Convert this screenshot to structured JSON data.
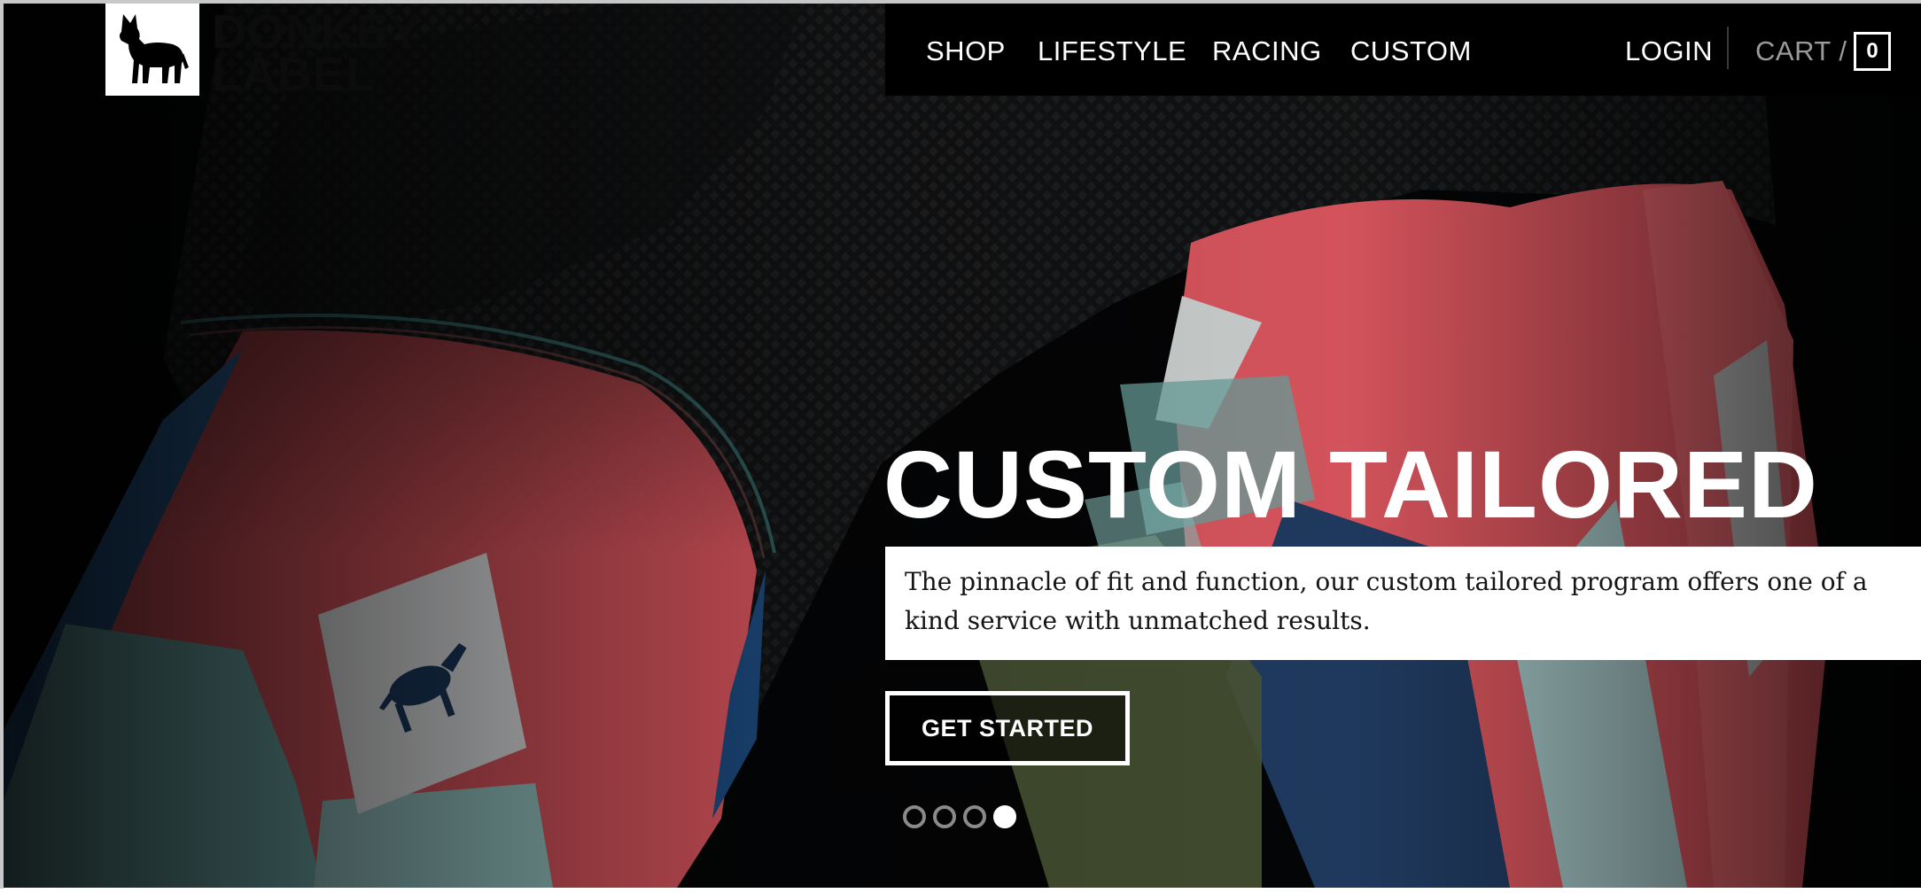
{
  "brand": {
    "logo_alt_text": "DONKEY LABEL",
    "logo_line1": "DONKEY",
    "logo_line2": "LABEL"
  },
  "nav": {
    "items": [
      {
        "label": "SHOP"
      },
      {
        "label": "LIFESTYLE"
      },
      {
        "label": "RACING"
      },
      {
        "label": "CUSTOM"
      }
    ],
    "login_label": "LOGIN",
    "cart_label": "CART /",
    "cart_count": "0"
  },
  "hero": {
    "headline": "CUSTOM TAILORED",
    "description": "The pinnacle of fit and function, our custom tailored program offers one of a kind service with unmatched results.",
    "cta_label": "GET STARTED",
    "slide_count": 4,
    "active_slide": 4
  },
  "colors": {
    "nav_background": "#000000",
    "accent_red": "#e8545e",
    "accent_blue": "#1e4f86",
    "accent_mint": "#a7dede",
    "text_white": "#ffffff"
  },
  "icons": {
    "logo": "donkey-silhouette-icon",
    "slide_dot": "slide-indicator-dot-icon"
  }
}
